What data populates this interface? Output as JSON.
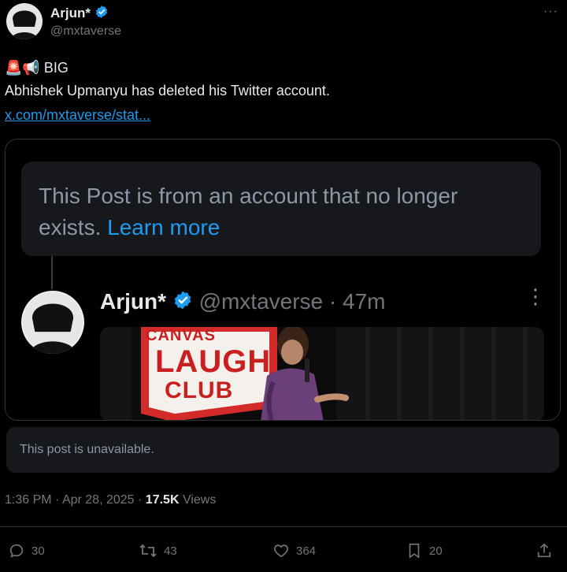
{
  "author": {
    "name": "Arjun*",
    "handle": "@mxtaverse"
  },
  "tweet": {
    "headline_emoji": "🚨📢",
    "headline": "BIG",
    "body": "Abhishek Upmanyu has deleted his Twitter account.",
    "link": "x.com/mxtaverse/stat..."
  },
  "quoted": {
    "deleted_notice": "This Post is from an account that no longer exists.",
    "learn_more": "Learn more",
    "name": "Arjun*",
    "handle": "@mxtaverse",
    "sep": "·",
    "time": "47m",
    "media": {
      "sign_line1": "CANVAS",
      "sign_line2": "LAUGH",
      "sign_line3": "CLUB"
    }
  },
  "unavailable": "This post is unavailable.",
  "meta": {
    "time": "1:36 PM",
    "date": "Apr 28, 2025",
    "sep": "·",
    "views_count": "17.5K",
    "views_label": "Views"
  },
  "actions": {
    "replies": "30",
    "reposts": "43",
    "likes": "364",
    "bookmarks": "20"
  },
  "colors": {
    "background": "#000000",
    "accent": "#1d9bf0",
    "muted": "#71767b",
    "border": "#2f3336"
  }
}
